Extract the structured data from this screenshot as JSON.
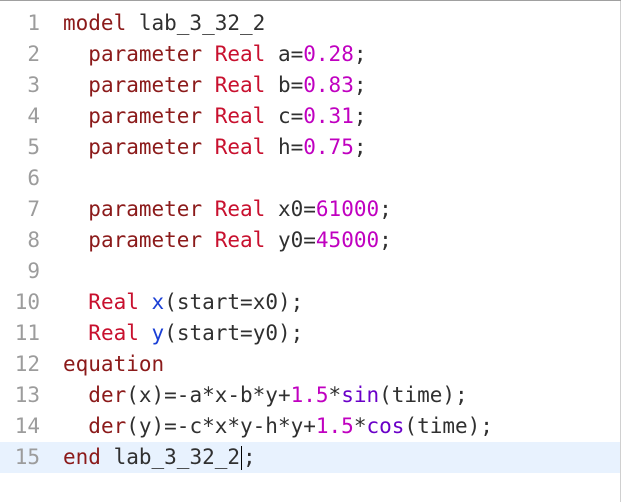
{
  "lines": [
    {
      "n": "1",
      "tokens": [
        [
          "kw",
          "model"
        ],
        [
          "id",
          " lab_3_32_2"
        ]
      ]
    },
    {
      "n": "2",
      "tokens": [
        [
          "id",
          "  "
        ],
        [
          "kw",
          "parameter"
        ],
        [
          "id",
          " "
        ],
        [
          "ty",
          "Real"
        ],
        [
          "id",
          " a="
        ],
        [
          "num",
          "0.28"
        ],
        [
          "id",
          ";"
        ]
      ]
    },
    {
      "n": "3",
      "tokens": [
        [
          "id",
          "  "
        ],
        [
          "kw",
          "parameter"
        ],
        [
          "id",
          " "
        ],
        [
          "ty",
          "Real"
        ],
        [
          "id",
          " b="
        ],
        [
          "num",
          "0.83"
        ],
        [
          "id",
          ";"
        ]
      ]
    },
    {
      "n": "4",
      "tokens": [
        [
          "id",
          "  "
        ],
        [
          "kw",
          "parameter"
        ],
        [
          "id",
          " "
        ],
        [
          "ty",
          "Real"
        ],
        [
          "id",
          " c="
        ],
        [
          "num",
          "0.31"
        ],
        [
          "id",
          ";"
        ]
      ]
    },
    {
      "n": "5",
      "tokens": [
        [
          "id",
          "  "
        ],
        [
          "kw",
          "parameter"
        ],
        [
          "id",
          " "
        ],
        [
          "ty",
          "Real"
        ],
        [
          "id",
          " h="
        ],
        [
          "num",
          "0.75"
        ],
        [
          "id",
          ";"
        ]
      ]
    },
    {
      "n": "6",
      "tokens": []
    },
    {
      "n": "7",
      "tokens": [
        [
          "id",
          "  "
        ],
        [
          "kw",
          "parameter"
        ],
        [
          "id",
          " "
        ],
        [
          "ty",
          "Real"
        ],
        [
          "id",
          " x0="
        ],
        [
          "num",
          "61000"
        ],
        [
          "id",
          ";"
        ]
      ]
    },
    {
      "n": "8",
      "tokens": [
        [
          "id",
          "  "
        ],
        [
          "kw",
          "parameter"
        ],
        [
          "id",
          " "
        ],
        [
          "ty",
          "Real"
        ],
        [
          "id",
          " y0="
        ],
        [
          "num",
          "45000"
        ],
        [
          "id",
          ";"
        ]
      ]
    },
    {
      "n": "9",
      "tokens": []
    },
    {
      "n": "10",
      "tokens": [
        [
          "id",
          "  "
        ],
        [
          "ty",
          "Real"
        ],
        [
          "id",
          " "
        ],
        [
          "blue",
          "x"
        ],
        [
          "id",
          "(start=x0);"
        ]
      ]
    },
    {
      "n": "11",
      "tokens": [
        [
          "id",
          "  "
        ],
        [
          "ty",
          "Real"
        ],
        [
          "id",
          " "
        ],
        [
          "blue",
          "y"
        ],
        [
          "id",
          "(start=y0);"
        ]
      ]
    },
    {
      "n": "12",
      "tokens": [
        [
          "kw",
          "equation"
        ]
      ]
    },
    {
      "n": "13",
      "tokens": [
        [
          "id",
          "  "
        ],
        [
          "kw",
          "der"
        ],
        [
          "id",
          "(x)=-a*x-b*y+"
        ],
        [
          "num",
          "1.5"
        ],
        [
          "id",
          "*"
        ],
        [
          "fn",
          "sin"
        ],
        [
          "id",
          "(time);"
        ]
      ]
    },
    {
      "n": "14",
      "tokens": [
        [
          "id",
          "  "
        ],
        [
          "kw",
          "der"
        ],
        [
          "id",
          "(y)=-c*x*y-h*y+"
        ],
        [
          "num",
          "1.5"
        ],
        [
          "id",
          "*"
        ],
        [
          "fn",
          "cos"
        ],
        [
          "id",
          "(time);"
        ]
      ]
    },
    {
      "n": "15",
      "tokens": [
        [
          "kw",
          "end"
        ],
        [
          "id",
          " lab_3_32_2"
        ],
        [
          "caret",
          ""
        ],
        [
          "id",
          ";"
        ]
      ],
      "current": true
    }
  ],
  "colors": {
    "keyword": "#8b1a1a",
    "type": "#c8102e",
    "number": "#c000c0",
    "function": "#6a00c8",
    "variable": "#1a3fd6",
    "line_number": "#9c9c9c",
    "current_line_bg": "#e8f2fe"
  }
}
